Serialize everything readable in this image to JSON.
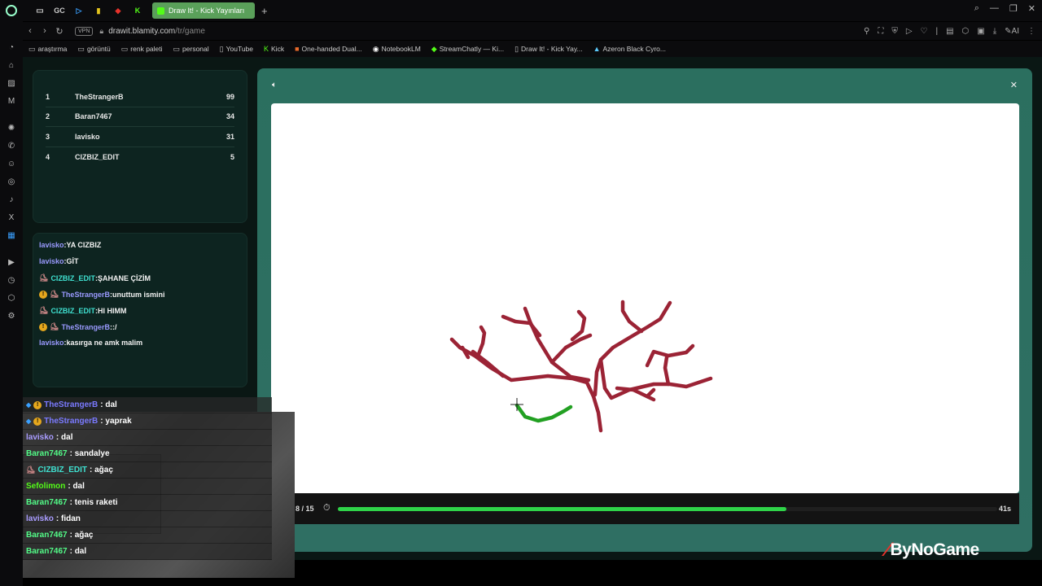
{
  "browser": {
    "tab_title": "Draw It! - Kick Yayınları",
    "new_tab": "+",
    "pinned_tabs": [
      "GC",
      "▷",
      "▮",
      "◆",
      "K"
    ],
    "url_host": "drawit.blamity.com",
    "url_path": "/tr/game",
    "vpn_label": "VPN",
    "bookmarks": [
      "araştırma",
      "görüntü",
      "renk paleti",
      "personal",
      "YouTube",
      "Kick",
      "One-handed Dual...",
      "NotebookLM",
      "StreamChatly — Ki...",
      "Draw It! - Kick Yay...",
      "Azeron Black Cyro..."
    ],
    "ai_label": "AI"
  },
  "scoreboard": [
    {
      "rank": "1",
      "name": "TheStrangerB",
      "points": "99"
    },
    {
      "rank": "2",
      "name": "Baran7467",
      "points": "34"
    },
    {
      "rank": "3",
      "name": "lavisko",
      "points": "31"
    },
    {
      "rank": "4",
      "name": "CIZBIZ_EDIT",
      "points": "5"
    }
  ],
  "chat": [
    {
      "user": "lavisko",
      "text": "YA CIZBIZ"
    },
    {
      "user": "lavisko",
      "text": "GİT"
    },
    {
      "user": "CIZBIZ_EDIT",
      "text": "ŞAHANE ÇİZİM"
    },
    {
      "user": "TheStrangerB",
      "text": "unuttum ismini"
    },
    {
      "user": "CIZBIZ_EDIT",
      "text": "HI HIMM"
    },
    {
      "user": "TheStrangerB",
      "text": ":/"
    },
    {
      "user": "lavisko",
      "text": "kasırga ne amk malim"
    }
  ],
  "game": {
    "round": "8 / 15",
    "time_left": "41s",
    "progress_fraction": 0.68,
    "drawing_color": "#9b2335",
    "current_stroke_color": "#22a022"
  },
  "overlay_chat": [
    {
      "user": "TheStrangerB",
      "text": ": dal",
      "color": "#7a7aff"
    },
    {
      "user": "TheStrangerB",
      "text": ": yaprak",
      "color": "#7a7aff"
    },
    {
      "user": "lavisko",
      "text": ": dal",
      "color": "#a99cff"
    },
    {
      "user": "Baran7467",
      "text": ": sandalye",
      "color": "#53fc88"
    },
    {
      "user": "CIZBIZ_EDIT",
      "text": ": ağaç",
      "color": "#3fe0d0"
    },
    {
      "user": "Sefolimon",
      "text": ": dal",
      "color": "#53fc18"
    },
    {
      "user": "Baran7467",
      "text": ": tenis raketi",
      "color": "#53fc88"
    },
    {
      "user": "lavisko",
      "text": ": fidan",
      "color": "#a99cff"
    },
    {
      "user": "Baran7467",
      "text": ": ağaç",
      "color": "#53fc88"
    },
    {
      "user": "Baran7467",
      "text": ": dal",
      "color": "#53fc88"
    }
  ],
  "brand": {
    "name": "ByNoGame"
  }
}
